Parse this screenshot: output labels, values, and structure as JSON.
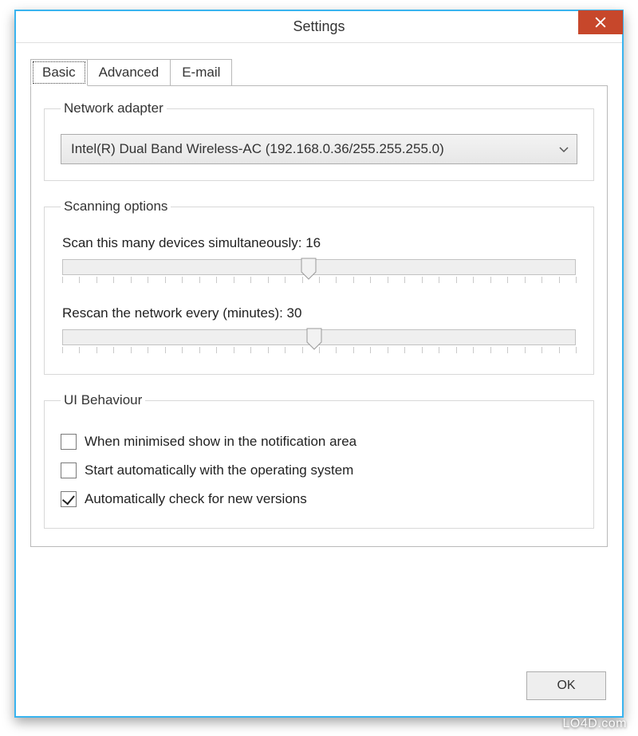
{
  "window": {
    "title": "Settings"
  },
  "tabs": [
    {
      "label": "Basic"
    },
    {
      "label": "Advanced"
    },
    {
      "label": "E-mail"
    }
  ],
  "groups": {
    "network": {
      "legend": "Network adapter",
      "adapter_value": "Intel(R) Dual Band Wireless-AC (192.168.0.36/255.255.255.0)"
    },
    "scanning": {
      "legend": "Scanning options",
      "simul_label_prefix": "Scan this many devices simultaneously: ",
      "simul_value": "16",
      "simul_full": "Scan this many devices simultaneously: 16",
      "simul_thumb_percent": 48,
      "rescan_label_prefix": "Rescan the network every (minutes): ",
      "rescan_value": "30",
      "rescan_full": "Rescan the network every (minutes): 30",
      "rescan_thumb_percent": 49
    },
    "ui": {
      "legend": "UI Behaviour",
      "opt_minimise": "When minimised show in the notification area",
      "opt_autostart": "Start automatically with the operating system",
      "opt_autoupdate": "Automatically check for new versions",
      "minimise_checked": false,
      "autostart_checked": false,
      "autoupdate_checked": true
    }
  },
  "buttons": {
    "ok": "OK"
  },
  "watermark": "LO4D.com"
}
